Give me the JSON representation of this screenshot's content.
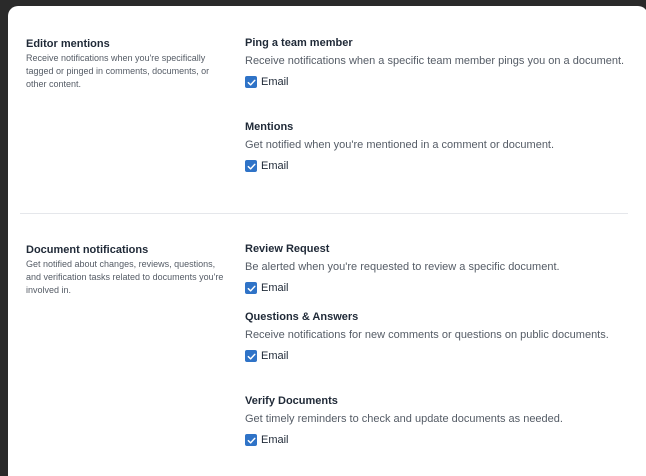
{
  "sections": [
    {
      "title": "Editor mentions",
      "description": "Receive notifications when you're specifically tagged or pinged in comments, documents, or other content.",
      "items": [
        {
          "title": "Ping a team member",
          "description": "Receive notifications when a specific team member pings you on a document.",
          "checkbox_label": "Email",
          "checked": true
        },
        {
          "title": "Mentions",
          "description": "Get notified when you're mentioned in a comment or document.",
          "checkbox_label": "Email",
          "checked": true
        }
      ]
    },
    {
      "title": "Document notifications",
      "description": "Get notified about changes, reviews, questions, and verification tasks related to documents you're involved in.",
      "items": [
        {
          "title": "Review Request",
          "description": "Be alerted when you're requested to review a specific document.",
          "checkbox_label": "Email",
          "checked": true
        },
        {
          "title": "Questions & Answers",
          "description": "Receive notifications for new comments or questions on public documents.",
          "checkbox_label": "Email",
          "checked": true
        },
        {
          "title": "Verify Documents",
          "description": "Get timely reminders to check and update documents as needed.",
          "checkbox_label": "Email",
          "checked": true
        }
      ]
    }
  ],
  "colors": {
    "checkbox": "#2f73c7",
    "background": "#2a2a2a",
    "card": "#ffffff"
  }
}
